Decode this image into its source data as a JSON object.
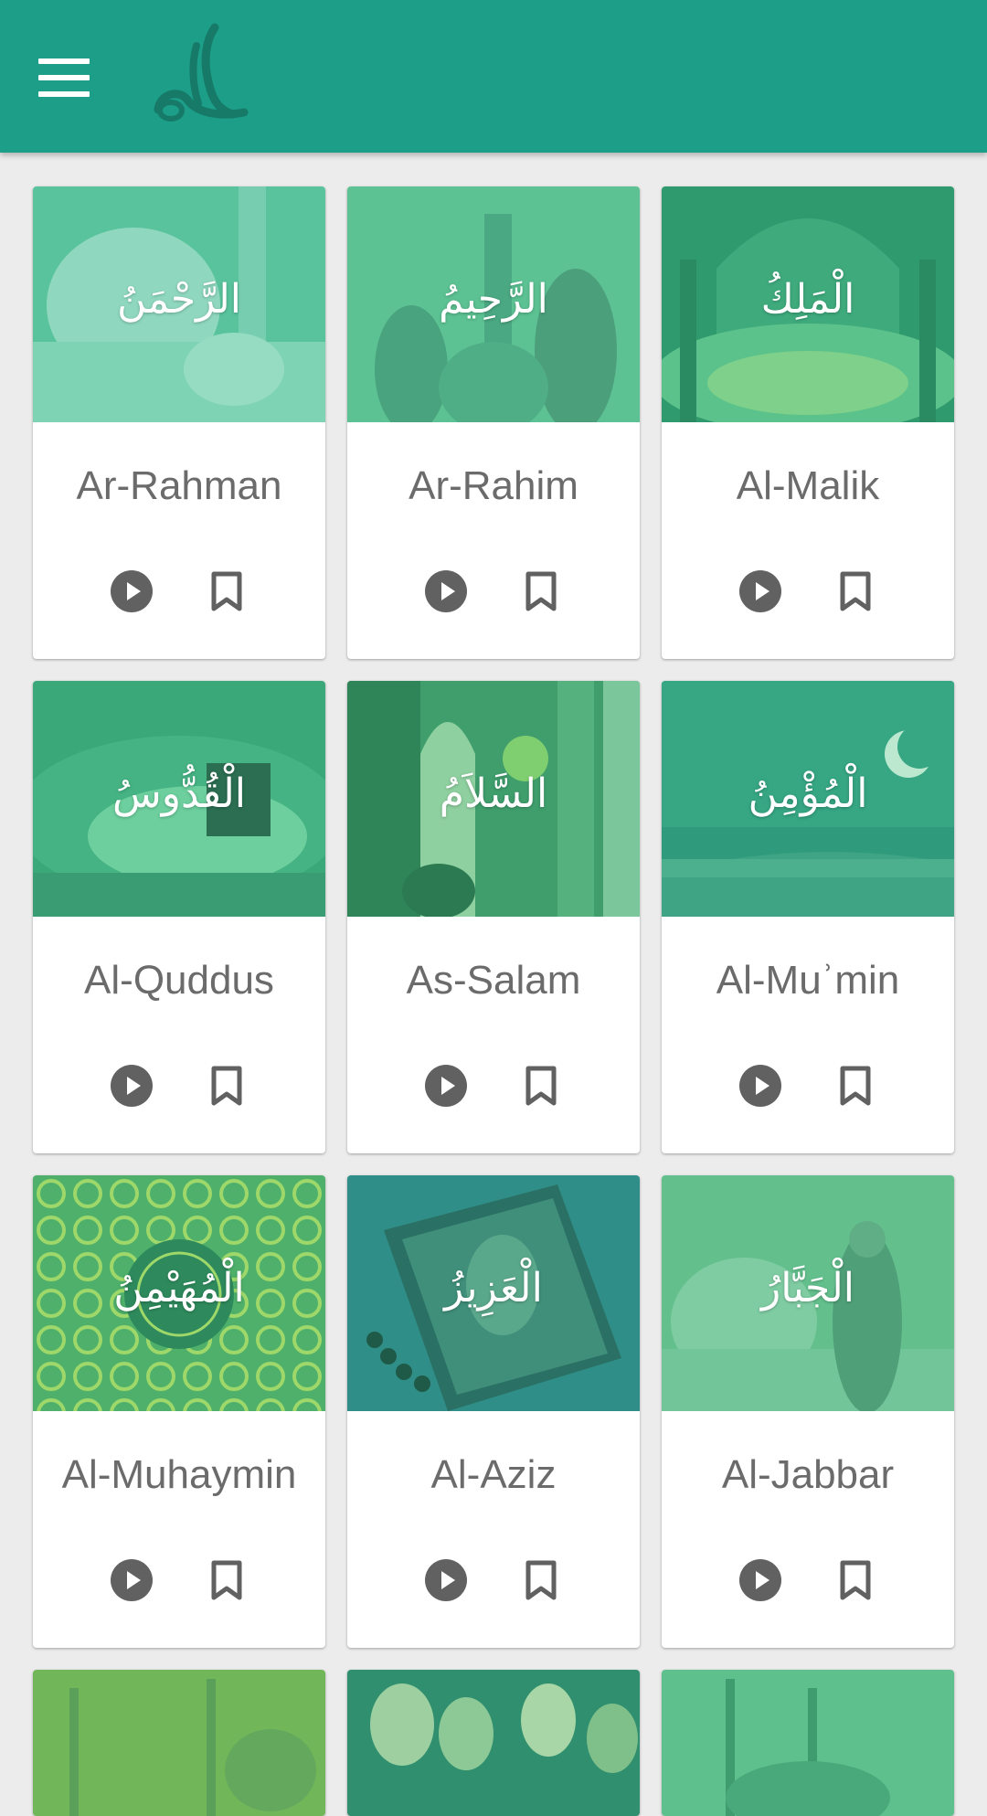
{
  "app_bar": {
    "color": "#1c9e88",
    "menu_icon": "hamburger-menu-icon",
    "logo": "allah-calligraphy-logo"
  },
  "names": [
    {
      "arabic": "الرَّحْمَنُ",
      "transliteration": "Ar-Rahman"
    },
    {
      "arabic": "الرَّحِيمُ",
      "transliteration": "Ar-Rahim"
    },
    {
      "arabic": "الْمَلِكُ",
      "transliteration": "Al-Malik"
    },
    {
      "arabic": "الْقُدُّوسُ",
      "transliteration": "Al-Quddus"
    },
    {
      "arabic": "السَّلاَمُ",
      "transliteration": "As-Salam"
    },
    {
      "arabic": "الْمُؤْمِنُ",
      "transliteration": "Al-Muʾmin"
    },
    {
      "arabic": "الْمُهَيْمِنُ",
      "transliteration": "Al-Muhaymin"
    },
    {
      "arabic": "الْعَزِيزُ",
      "transliteration": "Al-Aziz"
    },
    {
      "arabic": "الْجَبَّارُ",
      "transliteration": "Al-Jabbar"
    }
  ],
  "card_actions": {
    "play_icon": "play-circle-icon",
    "bookmark_icon": "bookmark-outline-icon",
    "icon_color": "#616161"
  },
  "overlay_color": "#2eb872"
}
